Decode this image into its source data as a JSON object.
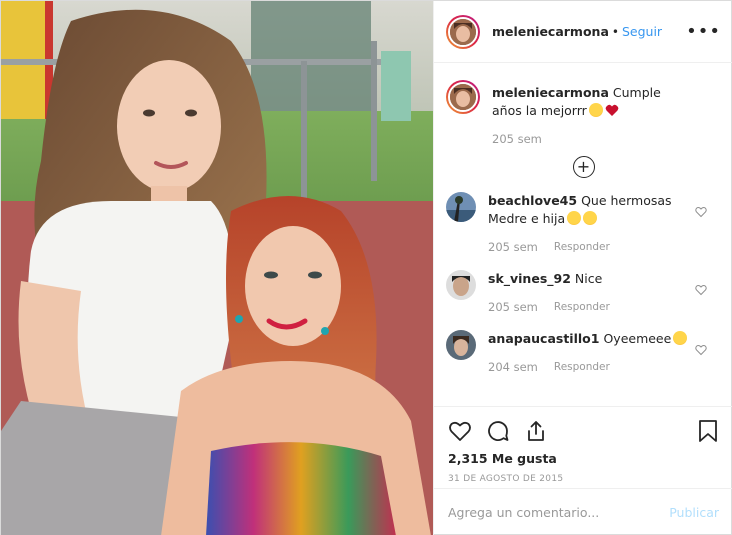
{
  "post": {
    "username": "meleniecarmona",
    "follow_label": "Seguir",
    "more_label": "•••"
  },
  "caption": {
    "username": "meleniecarmona",
    "text": "Cumple años la mejorrr",
    "time": "205 sem"
  },
  "load_more_label": "+",
  "comments": [
    {
      "username": "beachlove45",
      "text": "Que hermosas Medre e hija",
      "time": "205 sem",
      "reply": "Responder"
    },
    {
      "username": "sk_vines_92",
      "text": "Nice",
      "time": "205 sem",
      "reply": "Responder"
    },
    {
      "username": "anapaucastillo1",
      "text": "Oyeemeee",
      "time": "204 sem",
      "reply": "Responder"
    }
  ],
  "likes": "2,315 Me gusta",
  "date": "31 DE AGOSTO DE 2015",
  "add_comment": {
    "placeholder": "Agrega un comentario...",
    "publish": "Publicar"
  },
  "colors": {
    "link": "#3897f0",
    "muted": "#999999",
    "publish_disabled": "#b2dffc",
    "ring_start": "#f09433",
    "ring_end": "#bc1888"
  },
  "icons": [
    "heart-icon",
    "comment-icon",
    "share-icon",
    "bookmark-icon",
    "more-icon",
    "plus-circle-icon"
  ]
}
